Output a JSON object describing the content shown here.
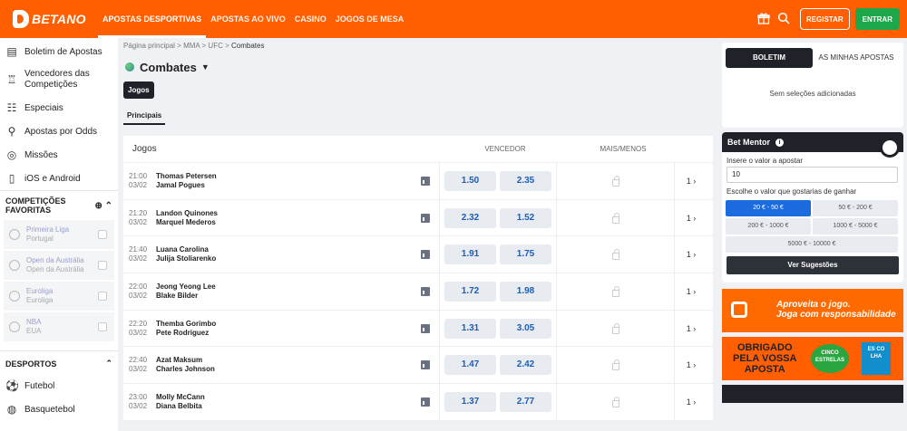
{
  "topbar": {
    "logo": "BETANO",
    "nav": [
      "APOSTAS DESPORTIVAS",
      "APOSTAS AO VIVO",
      "CASINO",
      "JOGOS DE MESA"
    ],
    "register_label": "REGISTAR",
    "login_label": "ENTRAR"
  },
  "sidebar": {
    "items": [
      {
        "label": "Boletim de Apostas",
        "icon": "ticket-icon"
      },
      {
        "label": "Vencedores das Competições",
        "icon": "trophy-icon"
      },
      {
        "label": "Especiais",
        "icon": "specials-icon"
      },
      {
        "label": "Apostas por Odds",
        "icon": "odds-icon"
      },
      {
        "label": "Missões",
        "icon": "missions-icon"
      },
      {
        "label": "iOS e Android",
        "icon": "mobile-icon"
      }
    ],
    "favorites_title": "COMPETIÇÕES FAVORITAS",
    "favorites": [
      {
        "name": "Primeira Liga",
        "sub": "Portugal"
      },
      {
        "name": "Open da Austrália",
        "sub": "Open da Austrália"
      },
      {
        "name": "Euroliga",
        "sub": "Euroliga"
      },
      {
        "name": "NBA",
        "sub": "EUA"
      }
    ],
    "sports_title": "DESPORTOS",
    "sports": [
      {
        "label": "Futebol"
      },
      {
        "label": "Basquetebol"
      }
    ]
  },
  "main": {
    "breadcrumb": {
      "home": "Página principal",
      "sep1": " > ",
      "mma": "MMA",
      "sep2": " > ",
      "ufc": "UFC",
      "sep3": " > ",
      "current": "Combates"
    },
    "title": "Combates",
    "jogos_button": "Jogos",
    "tab_principais": "Principais",
    "headers": {
      "jogos": "Jogos",
      "vencedor": "VENCEDOR",
      "mais_menos": "MAIS/MENOS"
    },
    "events": [
      {
        "time": "21:00",
        "date": "03/02",
        "p1": "Thomas Petersen",
        "p2": "Jamal Pogues",
        "o1": "1.50",
        "o2": "2.35",
        "more": "1"
      },
      {
        "time": "21:20",
        "date": "03/02",
        "p1": "Landon Quinones",
        "p2": "Marquel Mederos",
        "o1": "2.32",
        "o2": "1.52",
        "more": "1"
      },
      {
        "time": "21:40",
        "date": "03/02",
        "p1": "Luana Carolina",
        "p2": "Julija Stoliarenko",
        "o1": "1.91",
        "o2": "1.75",
        "more": "1"
      },
      {
        "time": "22:00",
        "date": "03/02",
        "p1": "Jeong Yeong Lee",
        "p2": "Blake Bilder",
        "o1": "1.72",
        "o2": "1.98",
        "more": "1"
      },
      {
        "time": "22:20",
        "date": "03/02",
        "p1": "Themba Gorimbo",
        "p2": "Pete Rodriguez",
        "o1": "1.31",
        "o2": "3.05",
        "more": "1"
      },
      {
        "time": "22:40",
        "date": "03/02",
        "p1": "Azat Maksum",
        "p2": "Charles Johnson",
        "o1": "1.47",
        "o2": "2.42",
        "more": "1"
      },
      {
        "time": "23:00",
        "date": "03/02",
        "p1": "Molly McCann",
        "p2": "Diana Belbita",
        "o1": "1.37",
        "o2": "2.77",
        "more": "1"
      }
    ]
  },
  "right": {
    "slip_tab1": "BOLETIM",
    "slip_tab2": "AS MINHAS APOSTAS",
    "slip_empty": "Sem seleções adicionadas",
    "mentor_title": "Bet Mentor",
    "mentor_label1": "Insere o valor a apostar",
    "mentor_value": "10",
    "mentor_label2": "Escolhe o valor que gostarias de ganhar",
    "chips": [
      "20 € - 50 €",
      "50 € - 200 €",
      "200 € - 1000 €",
      "1000 € - 5000 €",
      "5000 € - 10000 €"
    ],
    "suggest_label": "Ver Sugestões",
    "promo1_line1": "Aproveita o jogo.",
    "promo1_line2": "Joga com responsabilidade",
    "promo2_line1": "OBRIGADO",
    "promo2_line2": "PELA VOSSA",
    "promo2_line3": "APOSTA",
    "promo2_badge": "CINCO ESTRELAS",
    "promo2_escolha": "ES CO LHA"
  },
  "colors": {
    "brand": "#ff5f00",
    "dark": "#1f2229",
    "odds_text": "#1c5db8",
    "login": "#1ca74b",
    "chip_active": "#1c6ce0"
  }
}
